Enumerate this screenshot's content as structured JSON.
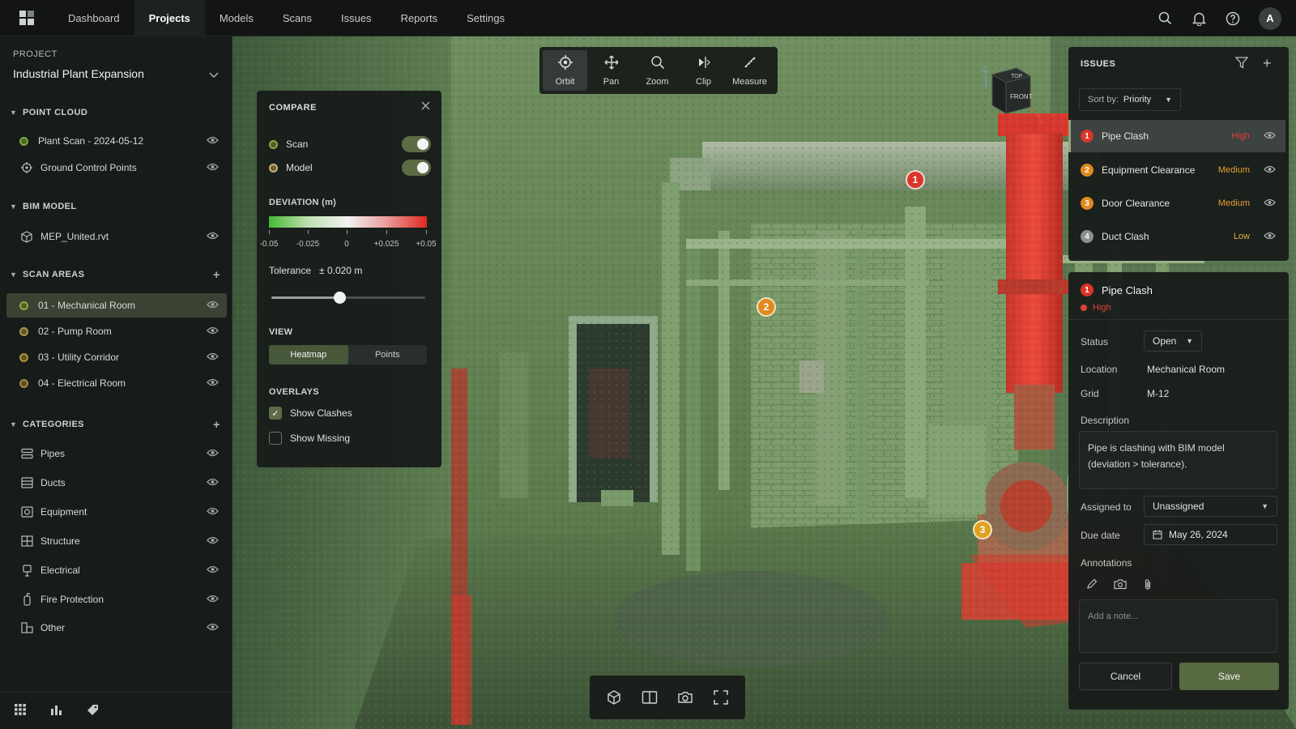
{
  "nav": {
    "items": [
      "Dashboard",
      "Projects",
      "Models",
      "Scans",
      "Issues",
      "Reports",
      "Settings"
    ],
    "active": "Projects",
    "avatar": "A",
    "icons": [
      "search-icon",
      "bell-icon",
      "help-icon"
    ]
  },
  "sidebar": {
    "project_label": "PROJECT",
    "project_name": "Industrial Plant Expansion",
    "point_cloud": {
      "title": "POINT CLOUD",
      "items": [
        {
          "label": "Plant Scan - 2024-05-12",
          "color": "#7aa83f"
        },
        {
          "label": "Ground Control Points",
          "icon": "target-icon"
        }
      ]
    },
    "bim_model": {
      "title": "BIM MODEL",
      "items": [
        {
          "label": "MEP_United.rvt",
          "icon": "cube-icon"
        }
      ]
    },
    "scan_areas": {
      "title": "SCAN AREAS",
      "items": [
        {
          "label": "01 - Mechanical Room",
          "color": "#8fa83f",
          "selected": true
        },
        {
          "label": "02 - Pump Room",
          "color": "#a89a4a"
        },
        {
          "label": "03 - Utility Corridor",
          "color": "#a8963f"
        },
        {
          "label": "04 - Electrical Room",
          "color": "#a88a3f"
        }
      ]
    },
    "categories": {
      "title": "CATEGORIES",
      "items": [
        {
          "label": "Pipes",
          "icon": "pipes-icon"
        },
        {
          "label": "Ducts",
          "icon": "ducts-icon"
        },
        {
          "label": "Equipment",
          "icon": "equipment-icon"
        },
        {
          "label": "Structure",
          "icon": "structure-icon"
        },
        {
          "label": "Electrical",
          "icon": "electrical-icon"
        },
        {
          "label": "Fire Protection",
          "icon": "fire-protection-icon"
        },
        {
          "label": "Other",
          "icon": "other-icon"
        }
      ]
    },
    "bottom_icons": [
      "grid-icon",
      "bar-chart-icon",
      "tag-icon"
    ]
  },
  "toolbar": {
    "tools": [
      {
        "label": "Orbit",
        "icon": "orbit-icon",
        "active": true
      },
      {
        "label": "Pan",
        "icon": "pan-icon"
      },
      {
        "label": "Zoom",
        "icon": "zoom-icon"
      },
      {
        "label": "Clip",
        "icon": "clip-icon"
      },
      {
        "label": "Measure",
        "icon": "measure-icon"
      }
    ]
  },
  "compare": {
    "title": "COMPARE",
    "layers": [
      {
        "label": "Scan",
        "color": "#8fa83f",
        "on": true
      },
      {
        "label": "Model",
        "color": "#c9b27a",
        "on": true
      }
    ],
    "deviation_label": "DEVIATION (m)",
    "ticks": [
      "-0.05",
      "-0.025",
      "0",
      "+0.025",
      "+0.05"
    ],
    "tolerance_label": "Tolerance",
    "tolerance_value": "± 0.020 m",
    "tolerance_fraction": 0.44,
    "view_label": "VIEW",
    "view_options": [
      "Heatmap",
      "Points"
    ],
    "view_selected": "Heatmap",
    "overlays_label": "OVERLAYS",
    "overlays": [
      {
        "label": "Show Clashes",
        "checked": true
      },
      {
        "label": "Show Missing",
        "checked": false
      }
    ]
  },
  "viewcube": {
    "top": "TOP",
    "front": "FRONT",
    "axis_z": "Z",
    "axis_x": "X"
  },
  "markers": [
    "1",
    "2",
    "3"
  ],
  "bottom_toolbar": [
    "cube-icon",
    "split-view-icon",
    "camera-icon",
    "fullscreen-icon"
  ],
  "issues": {
    "title": "ISSUES",
    "sort_label": "Sort by:",
    "sort_value": "Priority",
    "items": [
      {
        "num": "1",
        "label": "Pipe Clash",
        "priority": "High",
        "num_color": "#d9352b",
        "pri_color": "#e0403a",
        "selected": true
      },
      {
        "num": "2",
        "label": "Equipment Clearance",
        "priority": "Medium",
        "num_color": "#e08a1e",
        "pri_color": "#e8a030"
      },
      {
        "num": "3",
        "label": "Door Clearance",
        "priority": "Medium",
        "num_color": "#e08a1e",
        "pri_color": "#e8a030"
      },
      {
        "num": "4",
        "label": "Duct Clash",
        "priority": "Low",
        "num_color": "#8d918e",
        "pri_color": "#d8b23a"
      }
    ]
  },
  "detail": {
    "num": "1",
    "title": "Pipe Clash",
    "priority": "High",
    "status_label": "Status",
    "status_value": "Open",
    "location_label": "Location",
    "location_value": "Mechanical Room",
    "grid_label": "Grid",
    "grid_value": "M-12",
    "description_label": "Description",
    "description": "Pipe is clashing with BIM model (deviation > tolerance).",
    "assigned_label": "Assigned to",
    "assigned_value": "Unassigned",
    "due_label": "Due date",
    "due_value": "May 26, 2024",
    "annotations_label": "Annotations",
    "note_placeholder": "Add a note...",
    "cancel_label": "Cancel",
    "save_label": "Save"
  }
}
